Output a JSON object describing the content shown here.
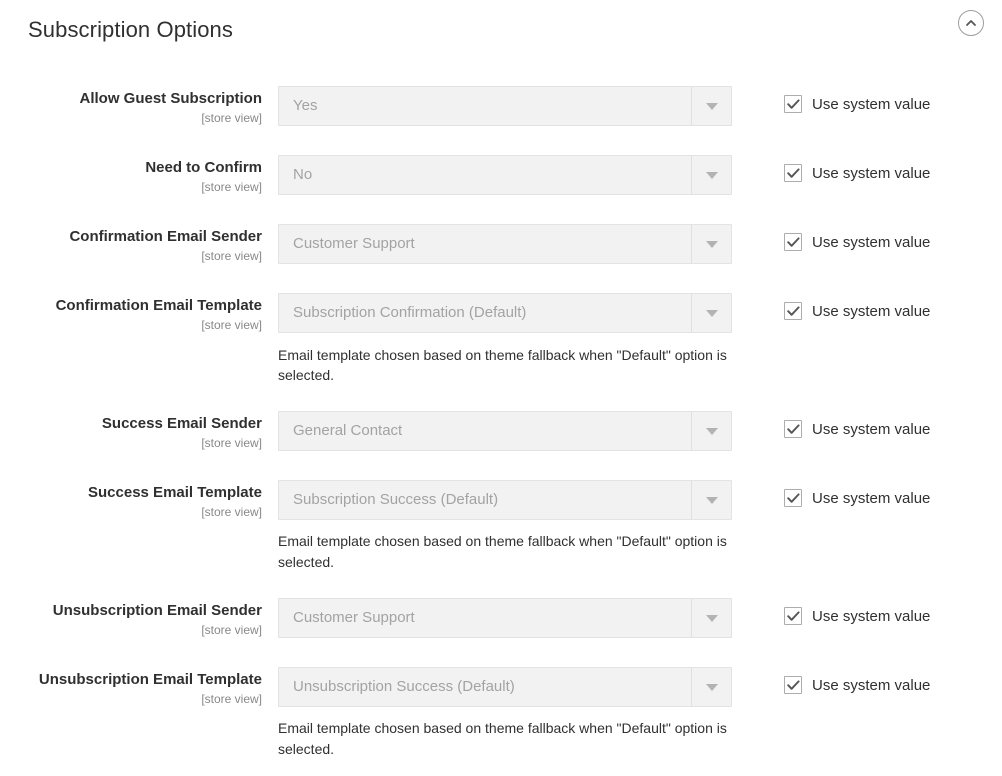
{
  "section": {
    "title": "Subscription Options",
    "collapse_icon": "chevron-up-circle-icon",
    "collapsed": false
  },
  "common": {
    "scope_label": "[store view]",
    "use_system_value_label": "Use system value",
    "dropdown_icon": "chevron-down-icon",
    "checkbox_icon": "checkmark-icon"
  },
  "colors": {
    "text": "#303030",
    "muted": "#888888",
    "disabled_value": "#a3a3a3",
    "field_bg": "#f2f2f2",
    "field_border": "#e3e3e3"
  },
  "fields": [
    {
      "id": "allow-guest-subscription",
      "label": "Allow Guest Subscription",
      "scope": "[store view]",
      "value": "Yes",
      "use_system_value": true,
      "note": null
    },
    {
      "id": "need-to-confirm",
      "label": "Need to Confirm",
      "scope": "[store view]",
      "value": "No",
      "use_system_value": true,
      "note": null
    },
    {
      "id": "confirmation-email-sender",
      "label": "Confirmation Email Sender",
      "scope": "[store view]",
      "value": "Customer Support",
      "use_system_value": true,
      "note": null
    },
    {
      "id": "confirmation-email-template",
      "label": "Confirmation Email Template",
      "scope": "[store view]",
      "value": "Subscription Confirmation (Default)",
      "use_system_value": true,
      "note": "Email template chosen based on theme fallback when \"Default\" option is selected."
    },
    {
      "id": "success-email-sender",
      "label": "Success Email Sender",
      "scope": "[store view]",
      "value": "General Contact",
      "use_system_value": true,
      "note": null
    },
    {
      "id": "success-email-template",
      "label": "Success Email Template",
      "scope": "[store view]",
      "value": "Subscription Success (Default)",
      "use_system_value": true,
      "note": "Email template chosen based on theme fallback when \"Default\" option is selected."
    },
    {
      "id": "unsubscription-email-sender",
      "label": "Unsubscription Email Sender",
      "scope": "[store view]",
      "value": "Customer Support",
      "use_system_value": true,
      "note": null
    },
    {
      "id": "unsubscription-email-template",
      "label": "Unsubscription Email Template",
      "scope": "[store view]",
      "value": "Unsubscription Success (Default)",
      "use_system_value": true,
      "note": "Email template chosen based on theme fallback when \"Default\" option is selected."
    }
  ]
}
